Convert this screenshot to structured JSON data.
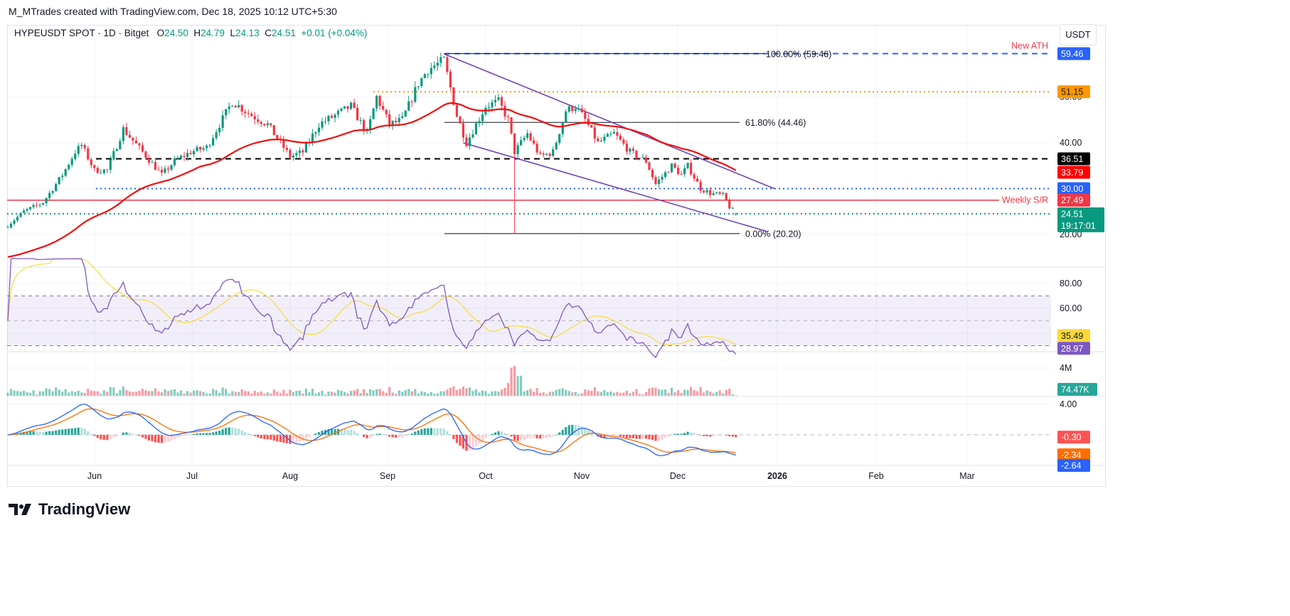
{
  "header": {
    "credit": "M_MTrades created with TradingView.com, Dec 18, 2025 10:12 UTC+5:30",
    "symbol": "HYPEUSDT SPOT · 1D · Bitget",
    "open_label": "O",
    "open": "24.50",
    "high_label": "H",
    "high": "24.79",
    "low_label": "L",
    "low": "24.13",
    "close_label": "C",
    "close": "24.51",
    "change": "+0.01 (+0.04%)",
    "currency": "USDT"
  },
  "logo": {
    "text": "TradingView",
    "icon": "tradingview-logo-icon"
  },
  "colors": {
    "up": "#089981",
    "down": "#f23645",
    "ma": "#f20d0d",
    "channel": "#673ab7",
    "rsi": "#7e57c2",
    "rsi_ma": "#f7dc3d",
    "macd": "#2962ff",
    "signal": "#ff6d00"
  },
  "chart_data": {
    "type": "candlestick",
    "start_date": "2025-05-05",
    "close_anchors": [
      [
        "2025-05-05",
        22
      ],
      [
        "2025-05-10",
        25
      ],
      [
        "2025-05-16",
        27
      ],
      [
        "2025-05-22",
        33
      ],
      [
        "2025-05-26",
        38
      ],
      [
        "2025-05-28",
        39.5
      ],
      [
        "2025-06-01",
        34
      ],
      [
        "2025-06-05",
        34
      ],
      [
        "2025-06-10",
        43
      ],
      [
        "2025-06-16",
        38
      ],
      [
        "2025-06-22",
        33
      ],
      [
        "2025-06-26",
        36
      ],
      [
        "2025-07-01",
        38
      ],
      [
        "2025-07-06",
        39
      ],
      [
        "2025-07-10",
        44
      ],
      [
        "2025-07-14",
        49
      ],
      [
        "2025-07-20",
        46
      ],
      [
        "2025-07-25",
        44
      ],
      [
        "2025-08-01",
        37
      ],
      [
        "2025-08-05",
        38
      ],
      [
        "2025-08-10",
        44
      ],
      [
        "2025-08-15",
        46
      ],
      [
        "2025-08-20",
        48
      ],
      [
        "2025-08-25",
        42
      ],
      [
        "2025-08-28",
        50
      ],
      [
        "2025-09-01",
        44
      ],
      [
        "2025-09-05",
        45
      ],
      [
        "2025-09-10",
        53
      ],
      [
        "2025-09-13",
        56
      ],
      [
        "2025-09-18",
        58
      ],
      [
        "2025-09-22",
        46
      ],
      [
        "2025-09-25",
        40
      ],
      [
        "2025-10-01",
        48
      ],
      [
        "2025-10-05",
        49
      ],
      [
        "2025-10-08",
        45
      ],
      [
        "2025-10-10",
        38
      ],
      [
        "2025-10-14",
        42
      ],
      [
        "2025-10-18",
        37
      ],
      [
        "2025-10-22",
        38
      ],
      [
        "2025-10-26",
        47
      ],
      [
        "2025-10-29",
        48
      ],
      [
        "2025-11-01",
        45
      ],
      [
        "2025-11-05",
        40
      ],
      [
        "2025-11-10",
        42
      ],
      [
        "2025-11-15",
        38
      ],
      [
        "2025-11-20",
        36
      ],
      [
        "2025-11-23",
        31
      ],
      [
        "2025-11-28",
        35
      ],
      [
        "2025-12-01",
        33
      ],
      [
        "2025-12-03",
        35
      ],
      [
        "2025-12-07",
        30
      ],
      [
        "2025-12-10",
        29
      ],
      [
        "2025-12-14",
        28.5
      ],
      [
        "2025-12-16",
        26
      ],
      [
        "2025-12-18",
        24.51
      ]
    ],
    "last_candle": {
      "open": 24.5,
      "high": 24.79,
      "low": 24.13,
      "close": 24.51
    },
    "october_10_low": 20.2,
    "price_axis": {
      "ticks": [
        "50.00",
        "40.00",
        "20.00"
      ],
      "range": [
        13,
        64
      ]
    },
    "time_axis": [
      "Jun",
      "Jul",
      "Aug",
      "Sep",
      "Oct",
      "Nov",
      "Dec",
      "2026",
      "Feb",
      "Mar"
    ],
    "moving_average": {
      "type": "EMA",
      "length": 50,
      "last": 33.79
    },
    "levels": [
      {
        "value": 59.46,
        "label": "59.46",
        "style": "dashed",
        "color": "#2962ff",
        "note": "New ATH"
      },
      {
        "value": 51.15,
        "label": "51.15",
        "style": "dotted",
        "color": "#ff9800"
      },
      {
        "value": 36.51,
        "label": "36.51",
        "style": "dashed",
        "color": "#000000"
      },
      {
        "value": 30.0,
        "label": "30.00",
        "style": "dotted",
        "color": "#2962ff"
      },
      {
        "value": 27.49,
        "label": "27.49",
        "style": "solid",
        "color": "#f23645",
        "note": "Weekly S/R"
      },
      {
        "value": 24.51,
        "label": "24.51",
        "style": "dotted",
        "color": "#089981",
        "countdown": "19:17:01"
      }
    ],
    "ma_tag": "33.79",
    "fibonacci": [
      {
        "level": "100.00% (59.46)",
        "value": 59.46
      },
      {
        "level": "61.80% (44.46)",
        "value": 44.46
      },
      {
        "level": "0.00% (20.20)",
        "value": 20.2
      }
    ],
    "channel": {
      "upper": [
        [
          "2025-09-18",
          59.4
        ],
        [
          "2025-12-30",
          30.0
        ]
      ],
      "lower": [
        [
          "2025-09-24",
          40.0
        ],
        [
          "2025-12-28",
          20.6
        ]
      ]
    },
    "rsi": {
      "length": 14,
      "ticks": [
        "80.00",
        "60.00"
      ],
      "bands": [
        30,
        50,
        70
      ],
      "value": "28.97",
      "ma_value": "35.49"
    },
    "volume": {
      "ticks": [
        "4M"
      ],
      "value": "74.47K"
    },
    "macd": {
      "ticks": [
        "4.00"
      ],
      "histogram": "-0.30",
      "signal": "-2.34",
      "macd": "-2.64"
    }
  }
}
